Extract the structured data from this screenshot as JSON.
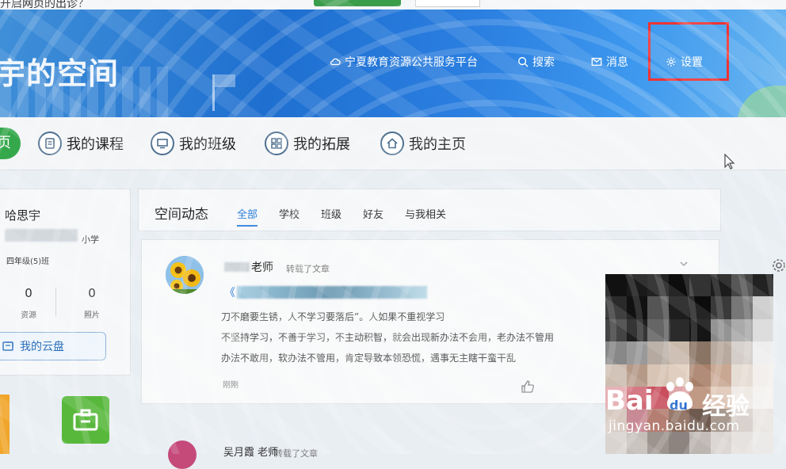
{
  "top": {
    "partial_text": "开启网页的出诊？"
  },
  "banner": {
    "space_title": "宇的空间",
    "platform": "宁夏教育资源公共服务平台",
    "search": "搜索",
    "messages": "消息",
    "settings": "设置"
  },
  "menu": {
    "home": "页",
    "items": [
      "我的课程",
      "我的班级",
      "我的拓展",
      "我的主页"
    ]
  },
  "profile": {
    "name": "哈思宇",
    "school_suffix": "小学",
    "grade": "四年级(5)班",
    "stats": [
      {
        "value": "0",
        "label": "资源"
      },
      {
        "value": "0",
        "label": "照片"
      }
    ],
    "cloud_disk": "我的云盘"
  },
  "feed": {
    "title": "空间动态",
    "tabs": [
      "全部",
      "学校",
      "班级",
      "好友",
      "与我相关"
    ],
    "post": {
      "author": "老师",
      "action": "转载了文章",
      "link_prefix": "《",
      "lines": [
        "刀不磨要生锈，人不学习要落后”。人如果不重视学习",
        "不坚持学习，不善于学习，不主动积智，就会出现新办法不会用，老办法不管用",
        "办法不敢用，软办法不管用，肯定导致本领恐慌，遇事无主瞎干蛮干乱"
      ],
      "time": "刚刚"
    },
    "post2": {
      "author": "吴月霞 老师",
      "action": "转载了文章"
    }
  },
  "watermark": {
    "brand_a": "Bai",
    "brand_b": "du",
    "brand_c": "经验",
    "url": "jingyan.baidu.com"
  },
  "colors": {
    "accent": "#2b7ed8",
    "home_green": "#36a84c",
    "highlight": "#e33333"
  }
}
